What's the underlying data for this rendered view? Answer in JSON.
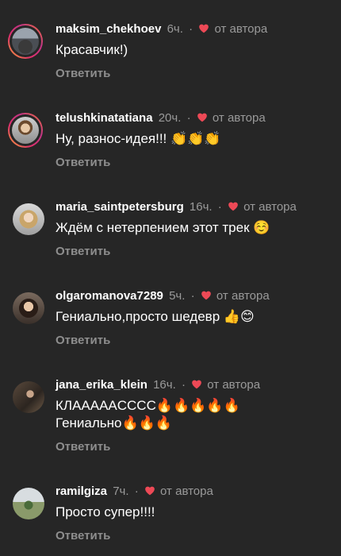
{
  "labels": {
    "author": "от автора",
    "reply": "Ответить",
    "dot": "·"
  },
  "colors": {
    "background": "#262626",
    "heart": "#ed4956",
    "muted": "#9a9a9a"
  },
  "comments": [
    {
      "username": "maksim_chekhoev",
      "time": "6ч.",
      "text": "Красавчик!)"
    },
    {
      "username": "telushkinatatiana",
      "time": "20ч.",
      "text": "Ну, разнос-идея!!! 👏👏👏"
    },
    {
      "username": "maria_saintpetersburg",
      "time": "16ч.",
      "text": "Ждём с нетерпением этот трек ☺️"
    },
    {
      "username": "olgaromanova7289",
      "time": "5ч.",
      "text": "Гениально,просто шедевр 👍😊"
    },
    {
      "username": "jana_erika_klein",
      "time": "16ч.",
      "text": "КЛААААACCCC🔥🔥🔥🔥🔥\nГениально🔥🔥🔥"
    },
    {
      "username": "ramilgiza",
      "time": "7ч.",
      "text": "Просто супер!!!!"
    }
  ]
}
